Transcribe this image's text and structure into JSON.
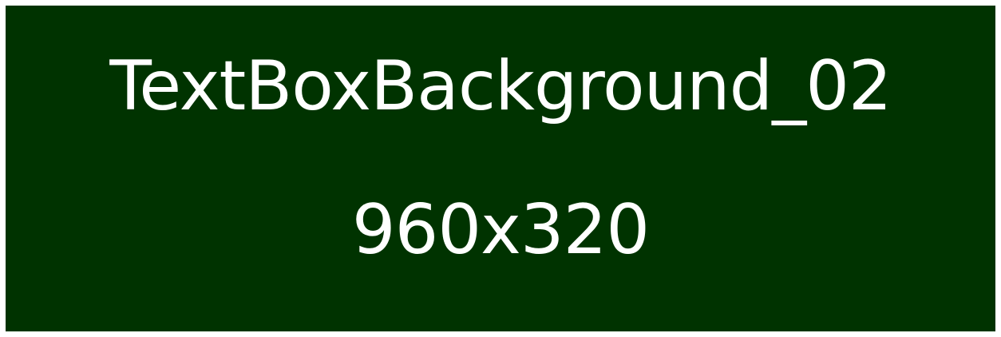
{
  "panel": {
    "title": "TextBoxBackground_02",
    "size_label": "960x320",
    "background_color": "#003300",
    "text_color": "#ffffff",
    "border_color": "#ffffff"
  }
}
